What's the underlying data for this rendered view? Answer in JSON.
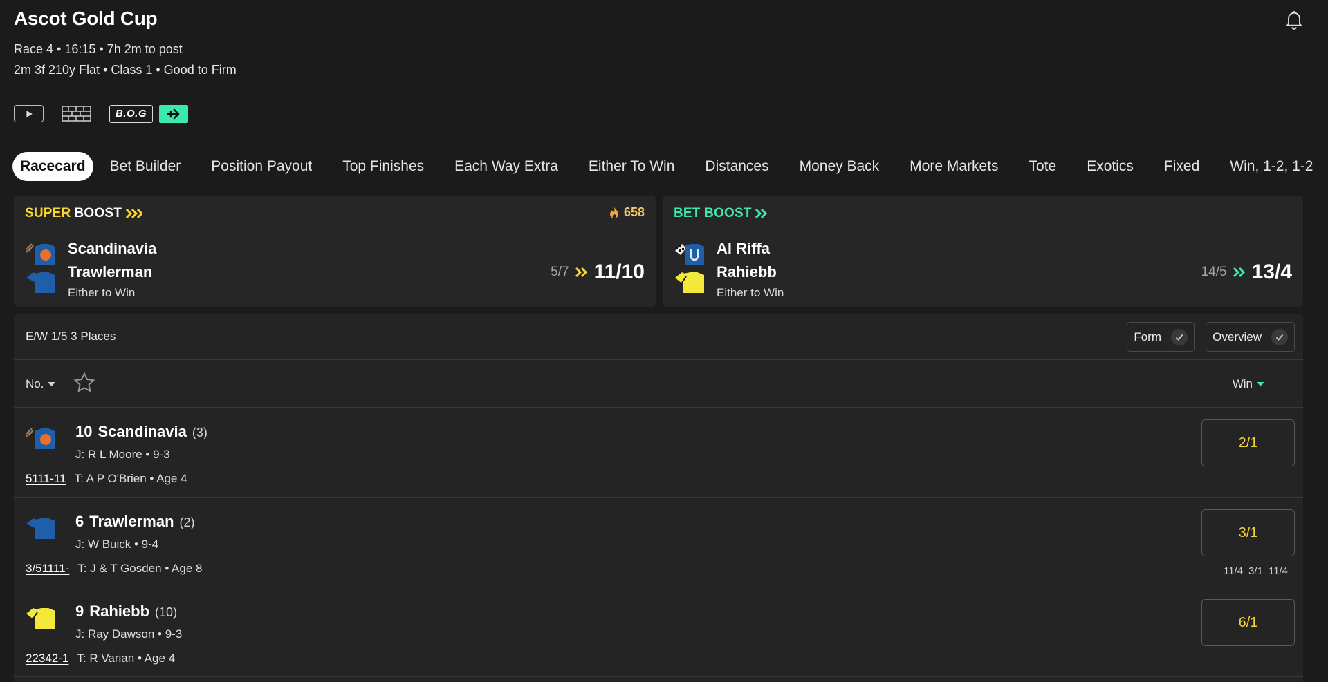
{
  "header": {
    "title": "Ascot Gold Cup",
    "subtitle_line1": "Race 4 • 16:15 • 7h 2m to post",
    "subtitle_line2": "2m 3f 210y Flat  • Class 1  • Good to Firm",
    "bog_label": "B.O.G"
  },
  "tabs": [
    {
      "label": "Racecard",
      "active": true
    },
    {
      "label": "Bet Builder"
    },
    {
      "label": "Position Payout"
    },
    {
      "label": "Top Finishes"
    },
    {
      "label": "Each Way Extra"
    },
    {
      "label": "Either To Win"
    },
    {
      "label": "Distances"
    },
    {
      "label": "Money Back"
    },
    {
      "label": "More Markets"
    },
    {
      "label": "Tote"
    },
    {
      "label": "Exotics"
    },
    {
      "label": "Fixed"
    },
    {
      "label": "Win, 1-2, 1-2"
    }
  ],
  "super_boost": {
    "title_a": "SUPER",
    "title_b": "BOOST",
    "count": "658",
    "selection1": "Scandinavia",
    "selection2": "Trawlerman",
    "market": "Either to Win",
    "old_odds": "5/7",
    "new_odds": "11/10",
    "accent": "#f8d62f"
  },
  "bet_boost": {
    "title": "BET BOOST",
    "selection1": "Al Riffa",
    "selection2": "Rahiebb",
    "market": "Either to Win",
    "old_odds": "14/5",
    "new_odds": "13/4",
    "accent": "#3be8b0"
  },
  "racecard": {
    "ew_terms": "E/W 1/5 3 Places",
    "form_toggle": "Form",
    "overview_toggle": "Overview",
    "sort_no": "No.",
    "sort_win": "Win",
    "runners": [
      {
        "no": "10",
        "name": "Scandinavia",
        "draw": "(3)",
        "jockey": "J: R L Moore • 9-3",
        "form": "5111-11",
        "trainer": "T: A P O'Brien • Age 4",
        "odds": "2/1",
        "history": []
      },
      {
        "no": "6",
        "name": "Trawlerman",
        "draw": "(2)",
        "jockey": "J: W Buick • 9-4",
        "form": "3/51111-",
        "trainer": "T: J & T Gosden • Age 8",
        "odds": "3/1",
        "history": [
          "11/4",
          "3/1",
          "11/4"
        ]
      },
      {
        "no": "9",
        "name": "Rahiebb",
        "draw": "(10)",
        "jockey": "J: Ray Dawson • 9-3",
        "form": "22342-1",
        "trainer": "T: R Varian • Age 4",
        "odds": "6/1",
        "history": []
      }
    ]
  },
  "colors": {
    "background": "#1b1b1b",
    "card": "#262626",
    "odds_text": "#f6cf3b",
    "bog_green": "#3be8b0"
  }
}
